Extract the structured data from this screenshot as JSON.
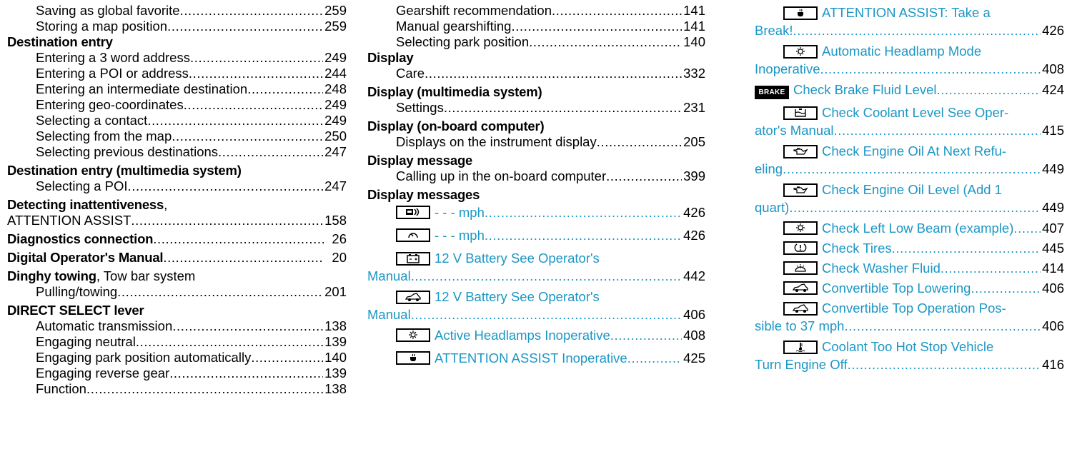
{
  "col1": {
    "r1": {
      "text": "Saving as global favorite",
      "page": "259"
    },
    "r2": {
      "text": "Storing a map position",
      "page": "259"
    },
    "h_dest": "Destination entry",
    "r3": {
      "text": "Entering a 3 word address",
      "page": "249"
    },
    "r4": {
      "text": "Entering a POI or address",
      "page": "244"
    },
    "r5": {
      "text": "Entering an intermediate destination",
      "page": "248"
    },
    "r6": {
      "text": "Entering geo-coordinates",
      "page": "249"
    },
    "r7": {
      "text": "Selecting a contact",
      "page": "249"
    },
    "r8": {
      "text": "Selecting from the map",
      "page": "250"
    },
    "r9": {
      "text": "Selecting previous destinations",
      "page": "247"
    },
    "h_destmm": "Destination entry (multimedia system)",
    "r10": {
      "text": "Selecting a POI",
      "page": "247"
    },
    "h_detect": "Detecting inattentiveness",
    "h_detect_suffix": ",",
    "r11": {
      "text": "ATTENTION ASSIST",
      "page": "158"
    },
    "h_diag": "Diagnostics connection",
    "diag_page": "26",
    "h_digital": "Digital Operator's Manual",
    "digital_page": "20",
    "h_dinghy": "Dinghy towing",
    "dinghy_suffix": ", Tow bar system",
    "r12": {
      "text": "Pulling/towing",
      "page": "201"
    },
    "h_direct": "DIRECT SELECT lever",
    "r13": {
      "text": "Automatic transmission",
      "page": "138"
    },
    "r14": {
      "text": "Engaging neutral",
      "page": "139"
    },
    "r15": {
      "text": "Engaging park position automatically",
      "page": "140"
    },
    "r16": {
      "text": "Engaging reverse gear",
      "page": "139"
    },
    "r17": {
      "text": "Function",
      "page": "138"
    }
  },
  "col2": {
    "r1": {
      "text": "Gearshift recommendation",
      "page": "141"
    },
    "r2": {
      "text": "Manual gearshifting",
      "page": "141"
    },
    "r3": {
      "text": "Selecting park position",
      "page": "140"
    },
    "h_display": "Display",
    "r4": {
      "text": "Care",
      "page": "332"
    },
    "h_display_mm": "Display (multimedia system)",
    "r5": {
      "text": "Settings",
      "page": "231"
    },
    "h_display_obc": "Display (on-board computer)",
    "r6": {
      "text": "Displays on the instrument display",
      "page": "205"
    },
    "h_msg": "Display message",
    "r7": {
      "text": "Calling up in the on-board computer",
      "page": "399"
    },
    "h_msgs": "Display messages",
    "m1": {
      "text": "- - - mph",
      "page": "426",
      "icon": "distance-assist-icon"
    },
    "m2": {
      "text": "- - - mph",
      "page": "426",
      "icon": "cruise-control-icon"
    },
    "m3": {
      "line1": "12 V Battery See Operator's",
      "line2": "Manual",
      "page": "442",
      "icon": "battery-icon"
    },
    "m4": {
      "line1": "12 V Battery See Operator's",
      "line2": "Manual",
      "page": "406",
      "icon": "convertible-car-icon"
    },
    "m5": {
      "text": "Active Headlamps Inoperative",
      "page": "408",
      "icon": "headlamp-sun-icon"
    },
    "m6": {
      "text": "ATTENTION ASSIST Inoperative",
      "page": "425",
      "icon": "coffee-cup-icon"
    }
  },
  "col3": {
    "m1": {
      "line1": "ATTENTION ASSIST: Take a",
      "line2": "Break!",
      "page": "426",
      "icon": "coffee-cup-icon"
    },
    "m2": {
      "line1": "Automatic Headlamp Mode",
      "line2": "Inoperative",
      "page": "408",
      "icon": "headlamp-sun-icon"
    },
    "m3": {
      "text": "Check Brake Fluid Level",
      "page": "424",
      "icon": "brake-icon",
      "badge": "BRAKE"
    },
    "m4": {
      "line1": "Check Coolant Level See Oper-",
      "line2": "ator's Manual",
      "page": "415",
      "icon": "coolant-reservoir-icon"
    },
    "m5": {
      "line1": "Check Engine Oil At Next Refu-",
      "line2": "eling",
      "page": "449",
      "icon": "oil-can-icon"
    },
    "m6": {
      "line1": "Check Engine Oil Level (Add 1",
      "line2": "quart)",
      "page": "449",
      "icon": "oil-can-icon"
    },
    "m7": {
      "text": "Check Left Low Beam (example)",
      "page": "407",
      "icon": "headlamp-sun-icon"
    },
    "m8": {
      "text": "Check Tires",
      "page": "445",
      "icon": "tire-pressure-icon"
    },
    "m9": {
      "text": "Check Washer Fluid",
      "page": "414",
      "icon": "washer-fluid-icon"
    },
    "m10": {
      "text": "Convertible Top Lowering",
      "page": "406",
      "icon": "convertible-car-icon"
    },
    "m11": {
      "line1": "Convertible Top Operation Pos-",
      "line2": "sible to 37 mph",
      "page": "406",
      "icon": "convertible-car-icon"
    },
    "m12": {
      "line1": "Coolant Too Hot Stop Vehicle",
      "line2": "Turn Engine Off",
      "page": "416",
      "icon": "coolant-temperature-icon"
    }
  }
}
